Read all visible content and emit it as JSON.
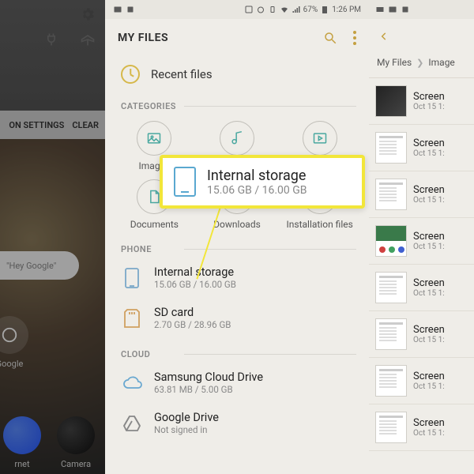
{
  "status": {
    "battery": "67%",
    "time": "1:26 PM"
  },
  "left": {
    "settings_btn": "ON SETTINGS",
    "clear_btn": "CLEAR",
    "search_placeholder": "\"Hey Google\"",
    "google_label": "Google",
    "internet_label": "rnet",
    "camera_label": "Camera"
  },
  "center": {
    "app_title": "MY FILES",
    "recent_label": "Recent files",
    "section_categories": "CATEGORIES",
    "section_phone": "PHONE",
    "section_cloud": "CLOUD",
    "categories": {
      "images": "Images",
      "audio": "Audio",
      "videos": "Videos",
      "documents": "Documents",
      "downloads": "Downloads",
      "install": "Installation files"
    },
    "phone": {
      "internal_title": "Internal storage",
      "internal_sub": "15.06 GB / 16.00 GB",
      "sd_title": "SD card",
      "sd_sub": "2.70 GB / 28.96 GB"
    },
    "cloud": {
      "samsung_title": "Samsung Cloud Drive",
      "samsung_sub": "63.81 MB / 5.00 GB",
      "gdrive_title": "Google Drive",
      "gdrive_sub": "Not signed in"
    }
  },
  "callout": {
    "title": "Internal storage",
    "sub": "15.06 GB / 16.00 GB"
  },
  "right": {
    "bc_root": "My Files",
    "bc_current": "Image",
    "row_title": "Screen",
    "row_sub": "Oct 15 1:"
  }
}
